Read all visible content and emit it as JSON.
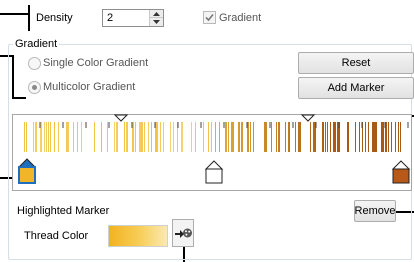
{
  "density": {
    "label": "Density",
    "value": "2"
  },
  "gradient_checkbox": {
    "label": "Gradient",
    "checked": true
  },
  "gradient_group": {
    "title": "Gradient"
  },
  "options": [
    {
      "label": "Single Color Gradient",
      "selected": false
    },
    {
      "label": "Multicolor Gradient",
      "selected": true
    }
  ],
  "buttons": {
    "reset": "Reset",
    "add_marker": "Add Marker",
    "remove": "Remove"
  },
  "highlighted": {
    "title": "Highlighted Marker",
    "thread_color_label": "Thread Color"
  },
  "icons": [
    "spin-up-icon",
    "spin-down-icon",
    "checkmark-icon",
    "radio-dot-icon",
    "top-marker-icon",
    "color-marker-icon",
    "color-picker-icon"
  ],
  "colors": {
    "gold": "#f0c040",
    "bronze": "#a85a14",
    "marker_blue": "#1e6fbf",
    "marker_gold": "#f0b528",
    "marker_bronze": "#b8591a"
  }
}
